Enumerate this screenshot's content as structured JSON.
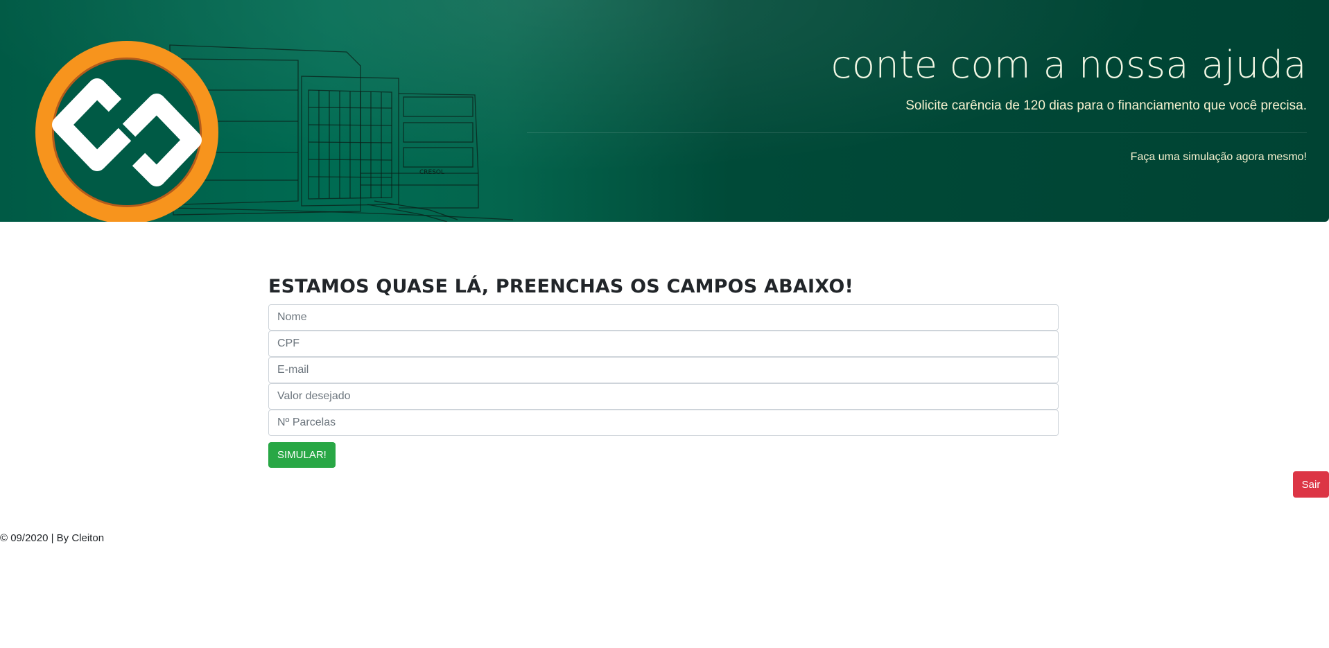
{
  "hero": {
    "title": "conte com a nossa ajuda",
    "subtitle": "Solicite carência de 120 dias para o financiamento que você precisa.",
    "cta": "Faça uma simulação agora mesmo!",
    "building_sign": "CRESOL",
    "colors": {
      "background": "#005a45",
      "logo_ring": "#f47f20",
      "text": "#f2f7e4"
    }
  },
  "form": {
    "title": "ESTAMOS QUASE LÁ, PREENCHAS OS CAMPOS ABAIXO!",
    "fields": [
      {
        "placeholder": "Nome",
        "value": ""
      },
      {
        "placeholder": "CPF",
        "value": ""
      },
      {
        "placeholder": "E-mail",
        "value": ""
      },
      {
        "placeholder": "Valor desejado",
        "value": ""
      },
      {
        "placeholder": "Nº Parcelas",
        "value": ""
      }
    ],
    "submit_label": "SIMULAR!",
    "submit_color": "#28a745"
  },
  "logout": {
    "label": "Sair",
    "color": "#dc3545"
  },
  "footer": {
    "text": "© 09/2020 | By Cleiton"
  }
}
